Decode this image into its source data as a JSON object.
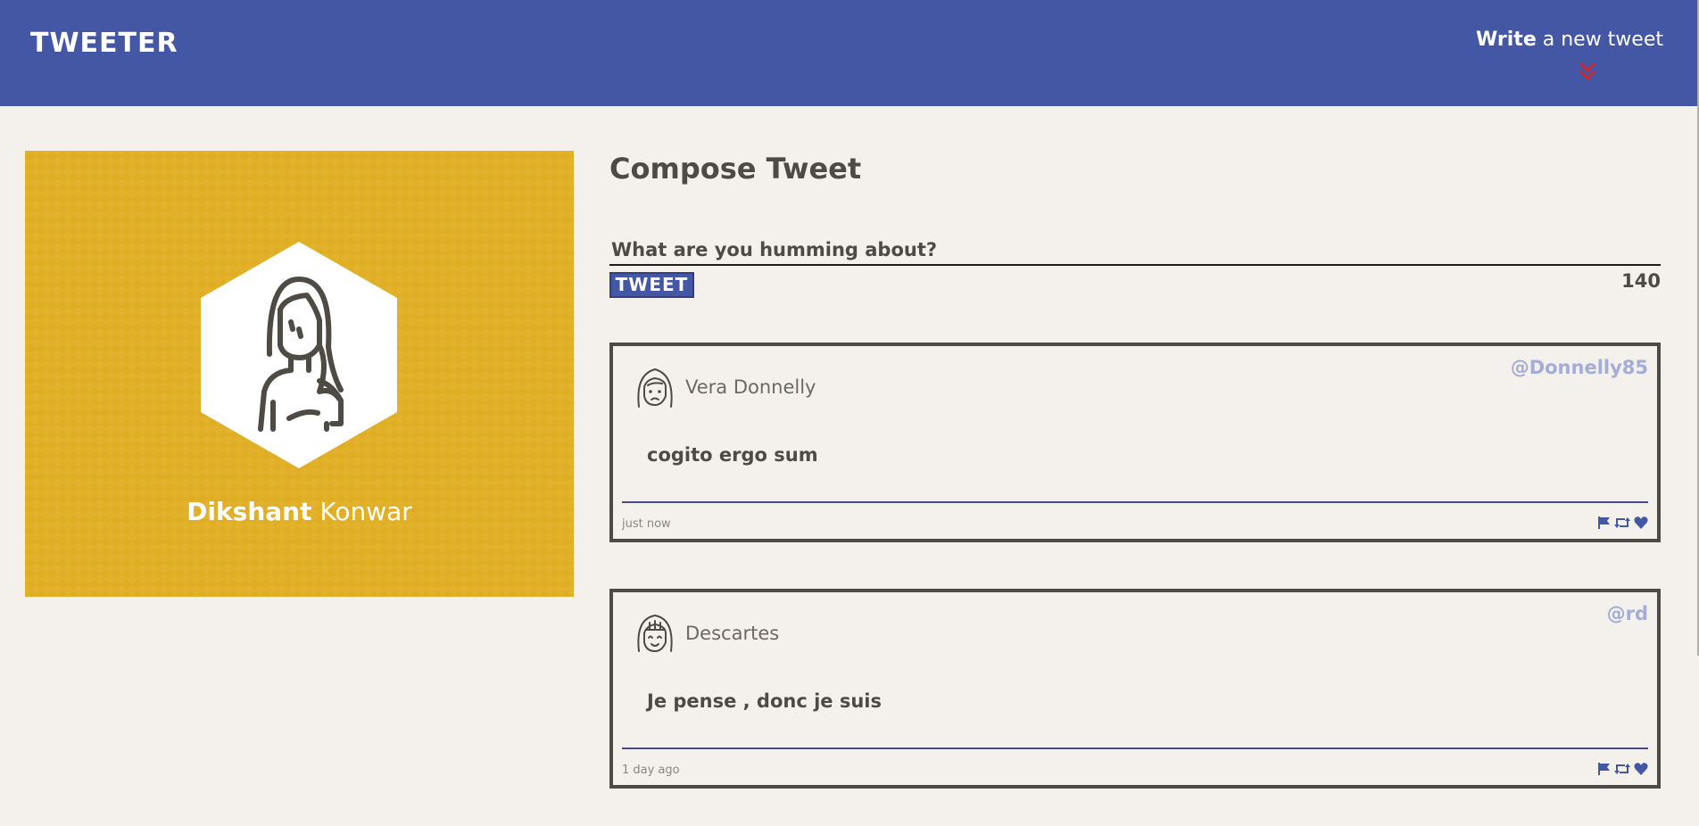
{
  "nav": {
    "brand": "TWEETER",
    "compose_bold": "Write",
    "compose_rest": " a new tweet",
    "colors": {
      "bar": "#4357a4",
      "chevron": "#c8282e"
    }
  },
  "profile": {
    "first_name": "Dikshant",
    "last_name": "Konwar",
    "background": "#e0ae22",
    "avatar_icon": "woman-avatar-icon"
  },
  "composer": {
    "title": "Compose Tweet",
    "placeholder": "What are you humming about?",
    "button_label": "TWEET",
    "counter": "140"
  },
  "tweets": [
    {
      "name": "Vera Donnelly",
      "handle": "@Donnelly85",
      "content": "cogito ergo sum",
      "time": "just now",
      "avatar_icon": "frowning-girl-avatar-icon"
    },
    {
      "name": "Descartes",
      "handle": "@rd",
      "content": "Je pense , donc je suis",
      "time": "1 day ago",
      "avatar_icon": "smiling-girl-avatar-icon"
    }
  ],
  "tweet_action_icons": [
    "flag-icon",
    "retweet-icon",
    "heart-icon"
  ]
}
